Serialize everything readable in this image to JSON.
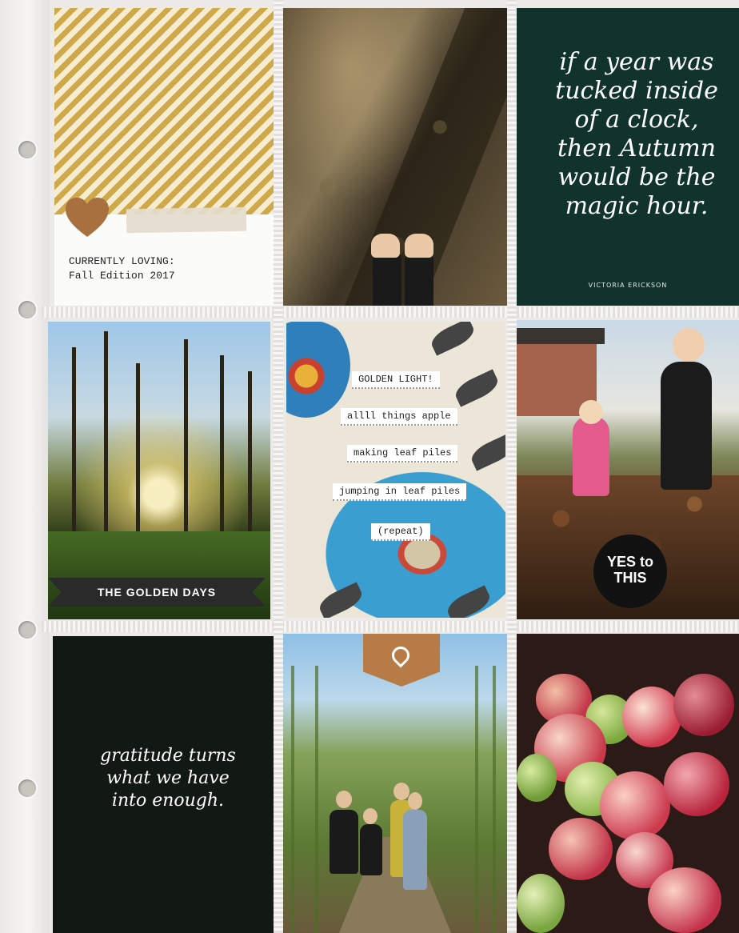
{
  "cards": {
    "currently_loving": {
      "line1": "CURRENTLY LOVING:",
      "line2": "Fall Edition 2017"
    },
    "autumn_quote": {
      "quote": "if a year was tucked inside of a clock, then Autumn would be the magic hour.",
      "credit": "VICTORIA ERICKSON"
    },
    "golden_days": {
      "banner": "THE GOLDEN DAYS"
    },
    "fall_list": {
      "items": [
        "GOLDEN LIGHT!",
        "allll things apple",
        "making leaf piles",
        "jumping in leaf piles",
        "(repeat)"
      ]
    },
    "leaf_pile": {
      "stamp": "YES to THIS"
    },
    "gratitude": {
      "quote": "gratitude turns what we have into enough."
    }
  },
  "colors": {
    "stripe_gold": "#cfa84a",
    "quote_green": "#10332d",
    "gratitude_black": "#121814",
    "cork": "#b77b48"
  },
  "icons": {
    "heart": "heart-icon",
    "location_pin": "location-pin-icon"
  }
}
